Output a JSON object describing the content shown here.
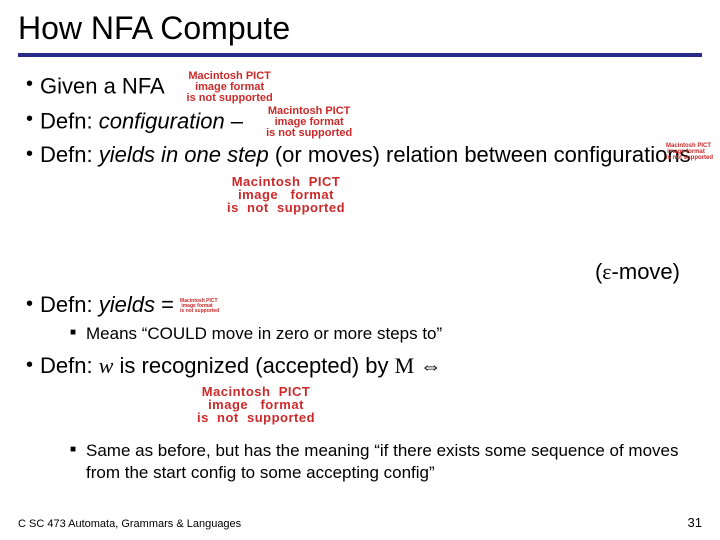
{
  "title": "How NFA Compute",
  "bullets": {
    "b1_pre": "Given a NFA",
    "b2_pre": "Defn:  ",
    "b2_em": "configuration",
    "b2_post": " – ",
    "b3_pre": "Defn:  ",
    "b3_em": "yields in one step ",
    "b3_post": " (or moves) relation between configurations",
    "b4_pre": "Defn: ",
    "b4_em": "yields",
    "b4_post": " = ",
    "b5_pre": "Defn:  ",
    "b5_var": "w",
    "b5_mid": " is recognized (accepted) by ",
    "b5_M": "M",
    "b5_iff": " ⇔"
  },
  "emove": {
    "open": "(",
    "eps": "ε",
    "rest": "-move)"
  },
  "sub1": "Means “COULD move  in zero or more steps to”",
  "sub2": "Same as before, but has the meaning “if there exists some sequence of moves from the start config to some accepting config”",
  "pict_lines": "Macintosh PICT\nimage format\nis not supported",
  "pict_lines_wide": "Macintosh  PICT\nimage   format\nis  not  supported",
  "footer_left": "C SC 473 Automata, Grammars & Languages",
  "footer_right": "31"
}
